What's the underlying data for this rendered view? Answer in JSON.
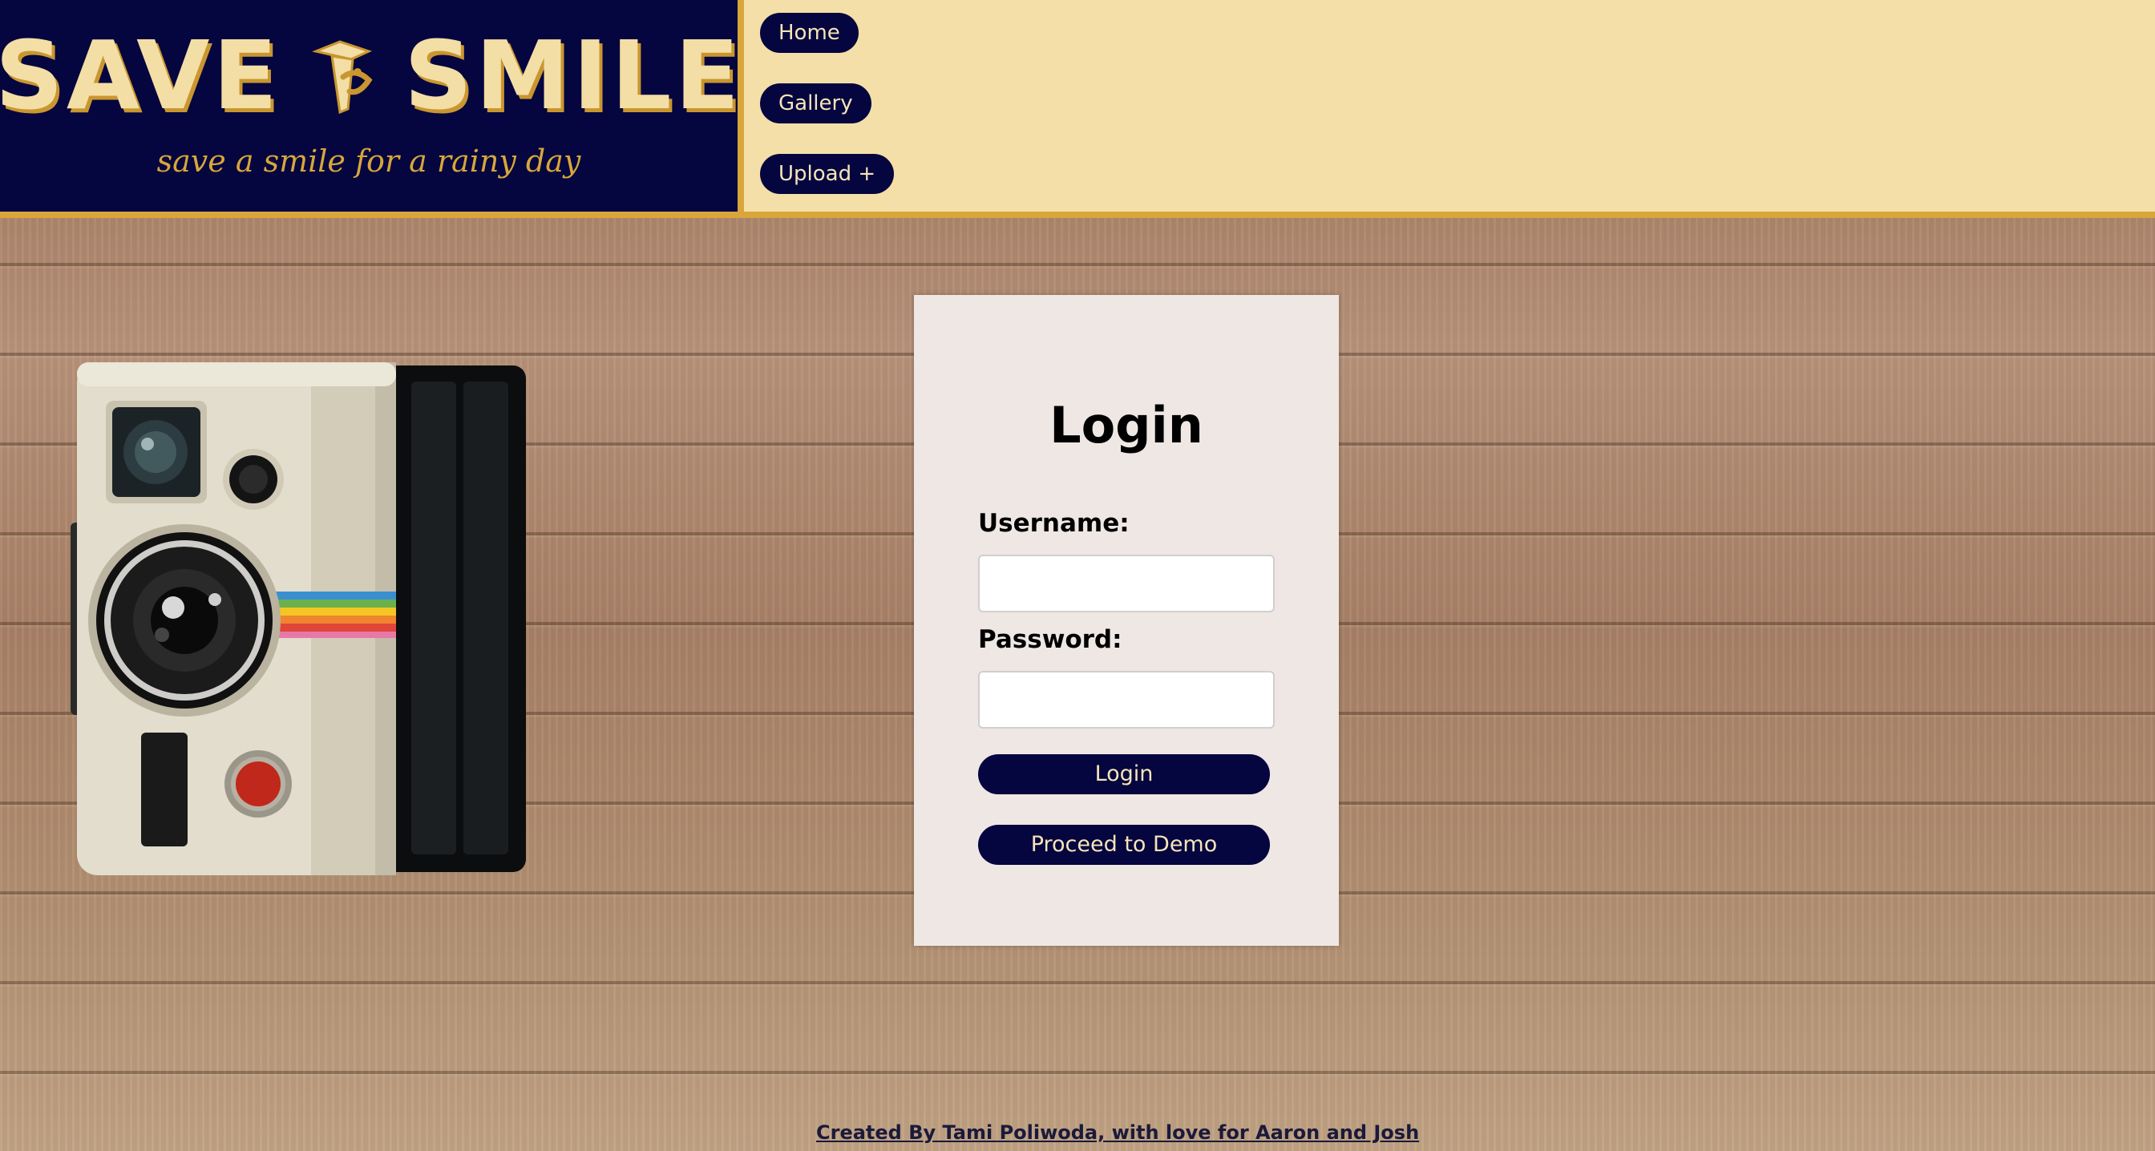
{
  "brand": {
    "title_left": "SAVE",
    "title_right": "SMILE",
    "logo_icon": "smile-cone-icon",
    "tagline": "save a smile for a rainy day"
  },
  "nav": {
    "items": [
      {
        "label": "Home"
      },
      {
        "label": "Gallery"
      },
      {
        "label": "Upload +"
      }
    ]
  },
  "login": {
    "title": "Login",
    "username_label": "Username:",
    "username_value": "",
    "password_label": "Password:",
    "password_value": "",
    "login_button": "Login",
    "demo_button": "Proceed to Demo"
  },
  "footer": {
    "credit": "Created By Tami Poliwoda, with love for Aaron and Josh"
  },
  "colors": {
    "navy": "#05053f",
    "cream": "#f4dfa8",
    "gold": "#d8a63a",
    "card": "#efe7e4"
  },
  "illustration": {
    "icon": "instant-camera-icon"
  }
}
